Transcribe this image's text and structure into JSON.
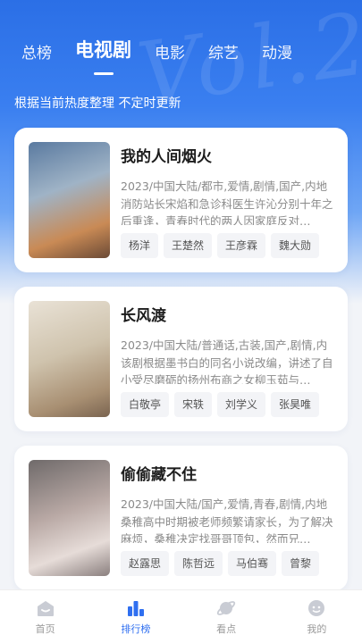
{
  "tabs": [
    {
      "label": "总榜",
      "active": false
    },
    {
      "label": "电视剧",
      "active": true
    },
    {
      "label": "电影",
      "active": false
    },
    {
      "label": "综艺",
      "active": false
    },
    {
      "label": "动漫",
      "active": false
    }
  ],
  "subtitle": "根据当前热度整理 不定时更新",
  "cards": [
    {
      "title": "我的人间烟火",
      "meta": "2023/中国大陆/都市,爱情,剧情,国产,内地",
      "desc": "消防站长宋焰和急诊科医生许沁分别十年之后重逢，青春时代的两人因家庭反对…",
      "actors": [
        "杨洋",
        "王楚然",
        "王彦霖",
        "魏大勋"
      ]
    },
    {
      "title": "长风渡",
      "meta": "2023/中国大陆/普通话,古装,国产,剧情,内",
      "desc": "该剧根据墨书白的同名小说改编，讲述了自小受尽磨砺的扬州布商之女柳玉茹与…",
      "actors": [
        "白敬亭",
        "宋轶",
        "刘学义",
        "张昊唯"
      ]
    },
    {
      "title": "偷偷藏不住",
      "meta": "2023/中国大陆/国产,爱情,青春,剧情,内地",
      "desc": "桑稚高中时期被老师频繁请家长，为了解决麻烦，桑稚决定找哥哥顶包，然而兄…",
      "actors": [
        "赵露思",
        "陈哲远",
        "马伯骞",
        "曾黎"
      ]
    }
  ],
  "nav": [
    {
      "label": "首页",
      "icon": "home-icon",
      "active": false
    },
    {
      "label": "排行榜",
      "icon": "ranking-icon",
      "active": true
    },
    {
      "label": "看点",
      "icon": "planet-icon",
      "active": false
    },
    {
      "label": "我的",
      "icon": "profile-icon",
      "active": false
    }
  ],
  "colors": {
    "accent": "#2f6ff0",
    "hero": "#2b6fe6"
  }
}
